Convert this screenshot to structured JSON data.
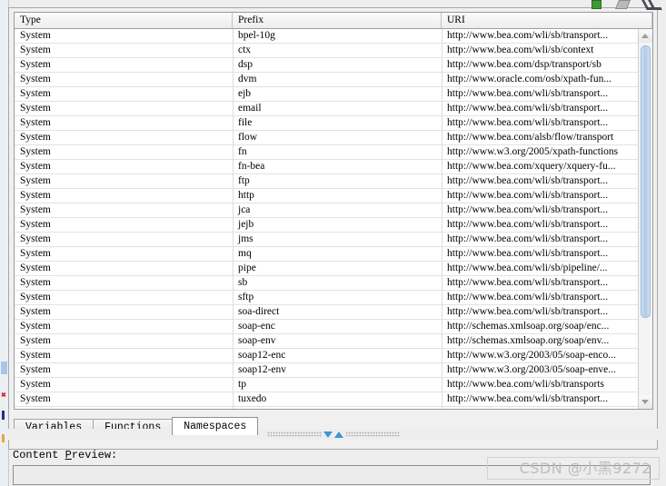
{
  "toolbar": {
    "icons": [
      {
        "name": "green-indicator-icon"
      },
      {
        "name": "pencil-edit-icon"
      },
      {
        "name": "double-chevron-icon"
      }
    ]
  },
  "table": {
    "columns": [
      "Type",
      "Prefix",
      "URI"
    ],
    "rows": [
      {
        "type": "System",
        "prefix": "bpel-10g",
        "uri": "http://www.bea.com/wli/sb/transport..."
      },
      {
        "type": "System",
        "prefix": "ctx",
        "uri": "http://www.bea.com/wli/sb/context"
      },
      {
        "type": "System",
        "prefix": "dsp",
        "uri": "http://www.bea.com/dsp/transport/sb"
      },
      {
        "type": "System",
        "prefix": "dvm",
        "uri": "http://www.oracle.com/osb/xpath-fun..."
      },
      {
        "type": "System",
        "prefix": "ejb",
        "uri": "http://www.bea.com/wli/sb/transport..."
      },
      {
        "type": "System",
        "prefix": "email",
        "uri": "http://www.bea.com/wli/sb/transport..."
      },
      {
        "type": "System",
        "prefix": "file",
        "uri": "http://www.bea.com/wli/sb/transport..."
      },
      {
        "type": "System",
        "prefix": "flow",
        "uri": "http://www.bea.com/alsb/flow/transport"
      },
      {
        "type": "System",
        "prefix": "fn",
        "uri": "http://www.w3.org/2005/xpath-functions"
      },
      {
        "type": "System",
        "prefix": "fn-bea",
        "uri": "http://www.bea.com/xquery/xquery-fu..."
      },
      {
        "type": "System",
        "prefix": "ftp",
        "uri": "http://www.bea.com/wli/sb/transport..."
      },
      {
        "type": "System",
        "prefix": "http",
        "uri": "http://www.bea.com/wli/sb/transport..."
      },
      {
        "type": "System",
        "prefix": "jca",
        "uri": "http://www.bea.com/wli/sb/transport..."
      },
      {
        "type": "System",
        "prefix": "jejb",
        "uri": "http://www.bea.com/wli/sb/transport..."
      },
      {
        "type": "System",
        "prefix": "jms",
        "uri": "http://www.bea.com/wli/sb/transport..."
      },
      {
        "type": "System",
        "prefix": "mq",
        "uri": "http://www.bea.com/wli/sb/transport..."
      },
      {
        "type": "System",
        "prefix": "pipe",
        "uri": "http://www.bea.com/wli/sb/pipeline/..."
      },
      {
        "type": "System",
        "prefix": "sb",
        "uri": "http://www.bea.com/wli/sb/transport..."
      },
      {
        "type": "System",
        "prefix": "sftp",
        "uri": "http://www.bea.com/wli/sb/transport..."
      },
      {
        "type": "System",
        "prefix": "soa-direct",
        "uri": "http://www.bea.com/wli/sb/transport..."
      },
      {
        "type": "System",
        "prefix": "soap-enc",
        "uri": "http://schemas.xmlsoap.org/soap/enc..."
      },
      {
        "type": "System",
        "prefix": "soap-env",
        "uri": "http://schemas.xmlsoap.org/soap/env..."
      },
      {
        "type": "System",
        "prefix": "soap12-enc",
        "uri": "http://www.w3.org/2003/05/soap-enco..."
      },
      {
        "type": "System",
        "prefix": "soap12-env",
        "uri": "http://www.w3.org/2003/05/soap-enve..."
      },
      {
        "type": "System",
        "prefix": "tp",
        "uri": "http://www.bea.com/wli/sb/transports"
      },
      {
        "type": "System",
        "prefix": "tuxedo",
        "uri": "http://www.bea.com/wli/sb/transport..."
      }
    ]
  },
  "tabs": [
    {
      "label": "Variables",
      "active": false
    },
    {
      "label": "Functions",
      "active": false
    },
    {
      "label": "Namespaces",
      "active": true
    }
  ],
  "preview": {
    "label_before": "Content ",
    "label_mnemonic": "P",
    "label_after": "review:",
    "value": ""
  },
  "watermark": {
    "text": "CSDN @小黑9272"
  },
  "colors": {
    "accent_blue": "#3d96d6",
    "scroll_thumb": "#aecbe8",
    "panel_bg": "#eeeeee",
    "table_bg": "#ffffff"
  }
}
